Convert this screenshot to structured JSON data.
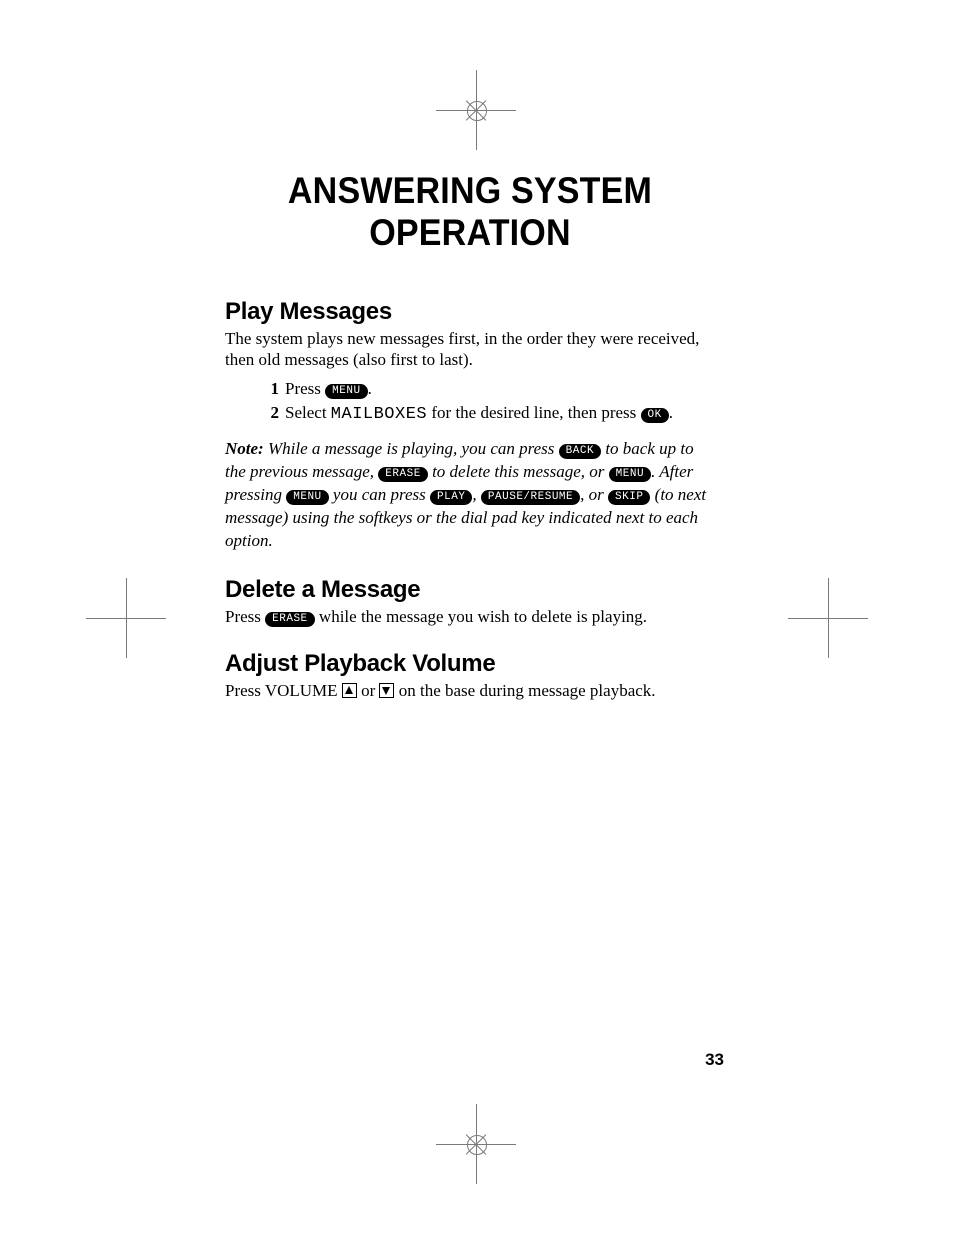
{
  "title": "ANSWERING SYSTEM OPERATION",
  "page_number": "33",
  "sections": {
    "play": {
      "heading": "Play Messages",
      "intro": "The system plays new messages first, in the order they were received, then old messages (also first to last).",
      "step1_a": "Press ",
      "step1_key": "MENU",
      "step1_b": ".",
      "step2_a": "Select ",
      "step2_mono": "MAILBOXES",
      "step2_b": " for the desired line, then press ",
      "step2_key": "OK",
      "step2_c": "."
    },
    "note": {
      "label": "Note:",
      "t1": " While a message is playing, you can press ",
      "k1": "BACK",
      "t2": " to back up to the previous message, ",
      "k2": "ERASE",
      "t3": " to delete this message, or ",
      "k3": "MENU",
      "t4": ". After pressing ",
      "k4": "MENU",
      "t5": " you can press ",
      "k5": "PLAY",
      "t6": ", ",
      "k6": "PAUSE/RESUME",
      "t7": ", or ",
      "k7": "SKIP",
      "t8": " (to next message) using the softkeys or the dial pad key indicated next to each option."
    },
    "delete": {
      "heading": "Delete a Message",
      "a": "Press ",
      "key": "ERASE",
      "b": " while the message you wish to delete is playing."
    },
    "volume": {
      "heading": "Adjust Playback Volume",
      "a": "Press VOLUME ",
      "b": " or ",
      "c": " on the base during message playback."
    }
  }
}
